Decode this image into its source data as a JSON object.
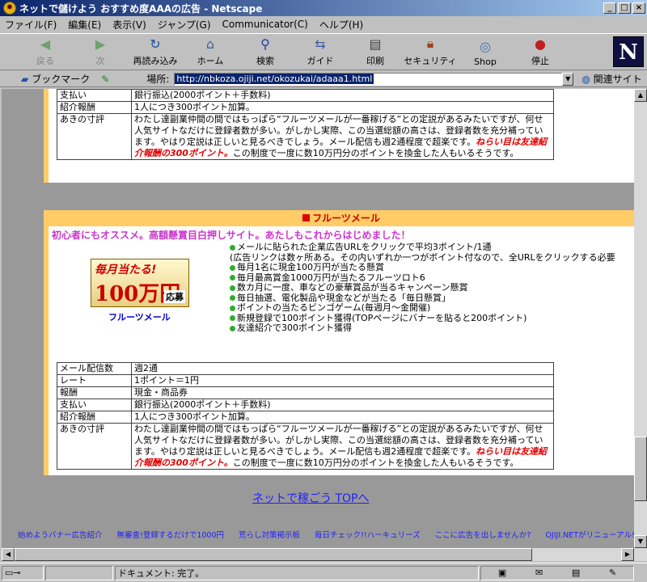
{
  "window": {
    "title": "ネットで儲けよう おすすめ度AAAの広告 - Netscape",
    "icon": "netscape-app-icon"
  },
  "menu": [
    "ファイル(F)",
    "編集(E)",
    "表示(V)",
    "ジャンプ(G)",
    "Communicator(C)",
    "ヘルプ(H)"
  ],
  "toolbar": {
    "back": "戻る",
    "forward": "次",
    "reload": "再読み込み",
    "home": "ホーム",
    "search": "検索",
    "guide": "ガイド",
    "print": "印刷",
    "security": "セキュリティ",
    "shop": "Shop",
    "stop": "停止",
    "logo": "N"
  },
  "location": {
    "bookmark_label": "ブックマーク",
    "label": "場所:",
    "url": "http://nbkoza.ojiji.net/okozukai/adaaa1.html",
    "related": "関連サイト"
  },
  "section1": {
    "rows": [
      {
        "k": "支払い",
        "v": "銀行振込(2000ポイント＋手数料)"
      },
      {
        "k": "紹介報酬",
        "v": "1人につき300ポイント加算。"
      }
    ],
    "comment_key": "あきの寸評",
    "comment_text": "わたし達副業仲間の間ではもっぱら“フルーツメールが一番稼げる”との定説があるみたいですが、何せ人気サイトなだけに登録者数が多い。がしかし実際、この当選総額の高さは、登録者数を充分補っています。やはり定説は正しいと見るべきでしょう。メール配信も週2通程度で超楽です。",
    "comment_emph": "ねらい目は友達紹介報酬の300ポイント。",
    "comment_tail": "この制度で一度に数10万円分のポイントを換金した人もいるそうです。"
  },
  "section2": {
    "title": "フルーツメール",
    "tagline": "初心者にもオススメ。高額懸賞目白押しサイト。あたしもこれからはじめました！",
    "banner": {
      "line1": "毎月当たる!",
      "line2": "100万円",
      "badge": "応募",
      "caption": "フルーツメール"
    },
    "features": [
      "メールに貼られた企業広告URLをクリックで平均3ポイント/1通",
      "(広告リンクは数ヶ所ある。その内いずれか一つがポイント付なので、全URLをクリックする必要",
      "毎月1名に現金100万円が当たる懸賞",
      "毎月最高賞金1000万円が当たるフルーツロト6",
      "数カ月に一度、車などの豪華賞品が当るキャンペーン懸賞",
      "毎日抽選、電化製品や現金などが当たる「毎日懸賞」",
      "ポイントの当たるビンゴゲーム(毎週月～金開催)",
      "新規登録で100ポイント獲得(TOPページにバナーを貼ると200ポイント)",
      "友達紹介で300ポイント獲得"
    ],
    "rows": [
      {
        "k": "メール配信数",
        "v": "週2通"
      },
      {
        "k": "レート",
        "v": "1ポイント＝1円"
      },
      {
        "k": "報酬",
        "v": "現金・商品券"
      },
      {
        "k": "支払い",
        "v": "銀行振込(2000ポイント＋手数料)"
      },
      {
        "k": "紹介報酬",
        "v": "1人につき300ポイント加算。"
      }
    ],
    "comment_key": "あきの寸評",
    "comment_text": "わたし達副業仲間の間ではもっぱら“フルーツメールが一番稼げる”との定説があるみたいですが、何せ人気サイトなだけに登録者数が多い。がしかし実際、この当選総額の高さは、登録者数を充分補っています。やはり定説は正しいと見るべきでしょう。メール配信も週2通程度で超楽です。",
    "comment_emph": "ねらい目は友達紹介報酬の300ポイント。",
    "comment_tail": "この制度で一度に数10万円分のポイントを換金した人もいるそうです。"
  },
  "top_link": "ネットで稼ごう TOPへ",
  "footer_links": [
    "始めようバナー広告紹介",
    "無審査!登録するだけで1000円",
    "荒らし対策掲示板",
    "毎日チェック!!ハーキュリーズ",
    "ここに広告を出しませんか?",
    "OJIJI.NETがリニューアル!!"
  ],
  "status": {
    "text": "ドキュメント: 完了。"
  },
  "colors": {
    "accent_orange": "#ffcc66",
    "link_blue": "#2020ff",
    "emph_red": "#e00000",
    "tagline_magenta": "#cc33cc"
  }
}
